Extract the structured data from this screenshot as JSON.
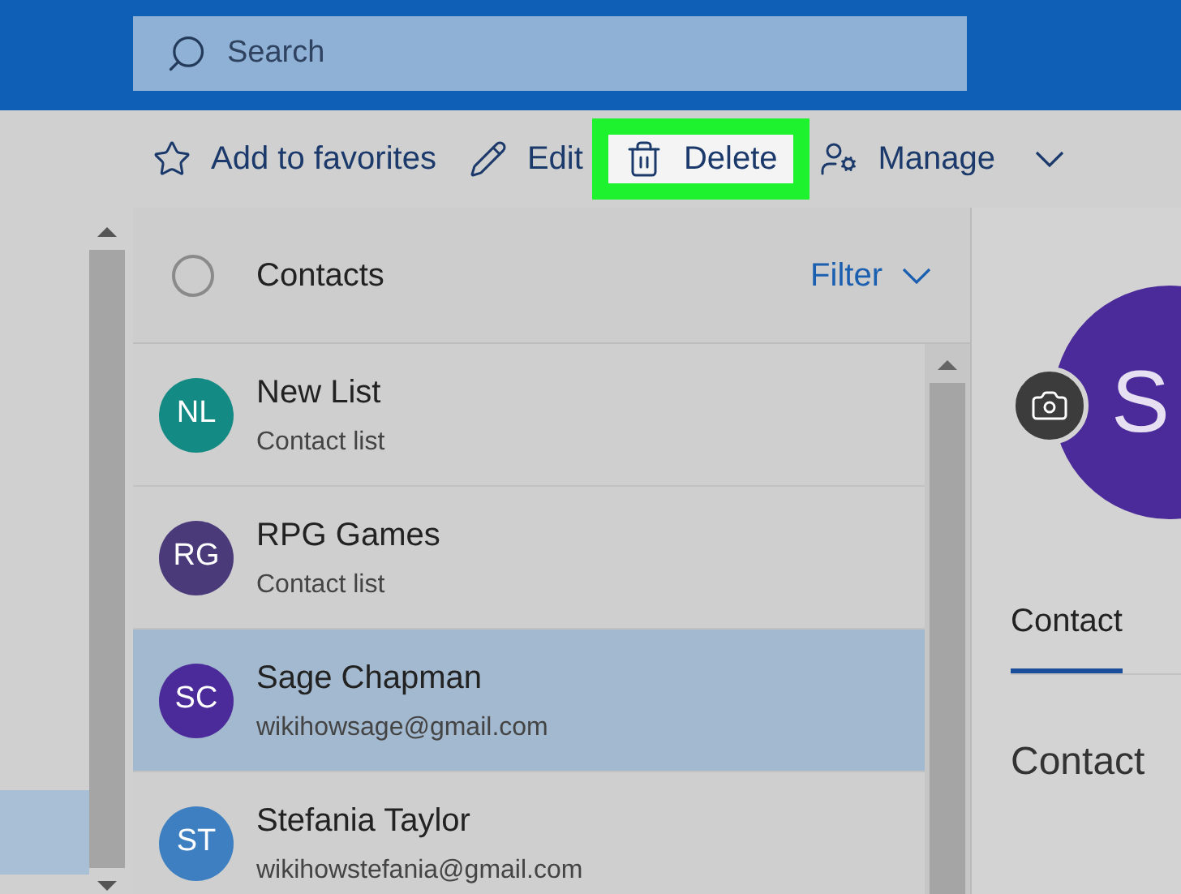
{
  "search": {
    "placeholder": "Search"
  },
  "toolbar": [
    {
      "kind": "star",
      "label": "Add to favorites",
      "highlighted": false,
      "dropdown": false
    },
    {
      "kind": "pencil",
      "label": "Edit",
      "highlighted": false,
      "dropdown": false
    },
    {
      "kind": "trash",
      "label": "Delete",
      "highlighted": true,
      "dropdown": false
    },
    {
      "kind": "manage",
      "label": "Manage",
      "highlighted": false,
      "dropdown": true
    }
  ],
  "list_header": {
    "title": "Contacts",
    "filter": "Filter",
    "checked": false
  },
  "contacts": [
    {
      "initials": "NL",
      "name": "New List",
      "detail": "Contact list",
      "color": "#138a83",
      "selected": false
    },
    {
      "initials": "RG",
      "name": "RPG Games",
      "detail": "Contact list",
      "color": "#4a3a7a",
      "selected": false
    },
    {
      "initials": "SC",
      "name": "Sage Chapman",
      "detail": "wikihowsage@gmail.com",
      "color": "#4b2a9a",
      "selected": true
    },
    {
      "initials": "ST",
      "name": "Stefania Taylor",
      "detail": "wikihowstefania@gmail.com",
      "color": "#3e7fc2",
      "selected": false
    }
  ],
  "detail": {
    "avatar_initials": "S",
    "tabs": [
      {
        "label": "Contact",
        "selected": true
      }
    ],
    "section_title": "Contact"
  }
}
